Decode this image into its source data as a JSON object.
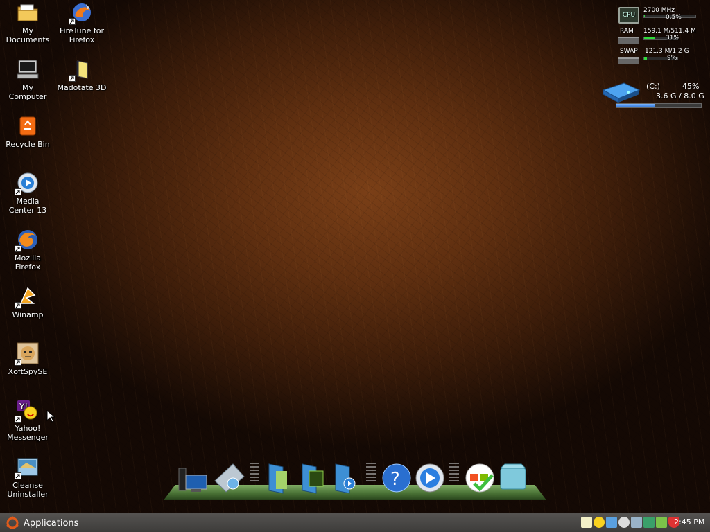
{
  "desktop": {
    "icons": [
      {
        "label_line1": "My",
        "label_line2": "Documents",
        "icon": "folder-documents-icon",
        "shortcut": false
      },
      {
        "label_line1": "FireTune for",
        "label_line2": "Firefox",
        "icon": "firetune-icon",
        "shortcut": true
      },
      {
        "label_line1": "My",
        "label_line2": "Computer",
        "icon": "computer-icon",
        "shortcut": false
      },
      {
        "label_line1": "Madotate 3D",
        "label_line2": "",
        "icon": "madotate-icon",
        "shortcut": true
      },
      {
        "label_line1": "Recycle Bin",
        "label_line2": "",
        "icon": "recycle-bin-icon",
        "shortcut": false
      },
      {
        "label_line1": "Media",
        "label_line2": "Center 13",
        "icon": "media-center-icon",
        "shortcut": true
      },
      {
        "label_line1": "Mozilla",
        "label_line2": "Firefox",
        "icon": "firefox-icon",
        "shortcut": true
      },
      {
        "label_line1": "Winamp",
        "label_line2": "",
        "icon": "winamp-icon",
        "shortcut": true
      },
      {
        "label_line1": "XoftSpySE",
        "label_line2": "",
        "icon": "xoftspy-icon",
        "shortcut": true
      },
      {
        "label_line1": "Yahoo!",
        "label_line2": "Messenger",
        "icon": "yahoo-messenger-icon",
        "shortcut": true
      },
      {
        "label_line1": "Cleanse",
        "label_line2": "Uninstaller",
        "icon": "cleanse-uninstaller-icon",
        "shortcut": true
      }
    ]
  },
  "monitor": {
    "cpu_label": "CPU",
    "cpu_freq": "2700 MHz",
    "cpu_usage": "0.5%",
    "cpu_fraction": 0.005,
    "ram_label": "RAM",
    "ram_value": "159.1 M/511.4 M",
    "ram_percent": "31%",
    "ram_fraction": 0.31,
    "swap_label": "SWAP",
    "swap_value": "121.3 M/1.2 G",
    "swap_percent": "9%",
    "swap_fraction": 0.09
  },
  "disk": {
    "name": "(C:)",
    "percent": "45%",
    "usage": "3.6 G / 8.0 G",
    "fraction": 0.45
  },
  "dock": {
    "items": [
      "computer-icon",
      "network-drive-icon",
      "documents-folder-icon",
      "pictures-folder-icon",
      "music-folder-icon",
      "help-icon",
      "media-player-icon",
      "windows-update-icon",
      "recycle-bin-icon"
    ]
  },
  "panel": {
    "applications_label": "Applications",
    "clock": "2:45 PM",
    "tray_icons": [
      "notes-icon",
      "smiley-icon",
      "text-editor-icon",
      "status-icon",
      "network-icon",
      "network-monitor-icon",
      "update-icon",
      "shield-icon"
    ]
  },
  "colors": {
    "panel_bg": "#4a4846",
    "usage_bar": "#2fdc3a",
    "disk_bar": "#2d72d6"
  }
}
